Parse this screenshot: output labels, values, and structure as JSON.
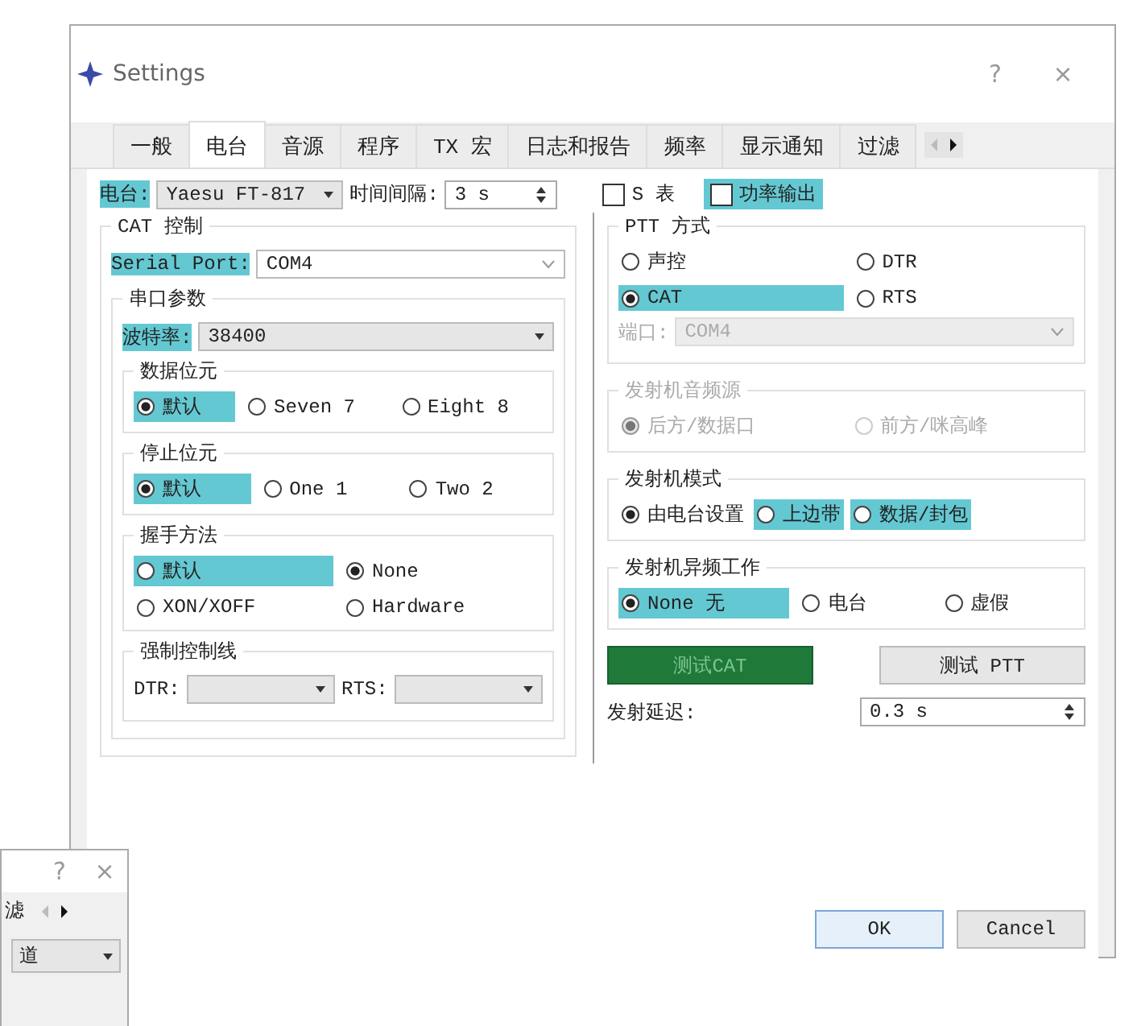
{
  "window": {
    "title": "Settings",
    "help": "?",
    "close": "×"
  },
  "tabs": [
    {
      "label": "一般",
      "selected": false
    },
    {
      "label": "电台",
      "selected": true
    },
    {
      "label": "音源",
      "selected": false
    },
    {
      "label": "程序",
      "selected": false
    },
    {
      "label": "TX 宏",
      "selected": false
    },
    {
      "label": "日志和报告",
      "selected": false
    },
    {
      "label": "频率",
      "selected": false
    },
    {
      "label": "显示通知",
      "selected": false
    },
    {
      "label": "过滤",
      "selected": false
    }
  ],
  "rig": {
    "label": "电台:",
    "value": "Yaesu FT-817",
    "highlighted": true
  },
  "poll_interval": {
    "label": "时间间隔:",
    "value": "3 s"
  },
  "checkboxes": [
    {
      "label": "S 表",
      "checked": false,
      "highlighted": false
    },
    {
      "label": "功率输出",
      "checked": false,
      "highlighted": true
    }
  ],
  "cat_control": {
    "title": "CAT 控制",
    "serial_port": {
      "label": "Serial Port:",
      "value": "COM4",
      "highlighted": true
    },
    "serial_params": {
      "title": "串口参数",
      "baud": {
        "label": "波特率:",
        "value": "38400",
        "highlighted": true
      },
      "groups": [
        {
          "title": "数据位元",
          "options": [
            {
              "label": "默认",
              "selected": true,
              "highlighted": true
            },
            {
              "label": "Seven 7",
              "selected": false,
              "highlighted": false
            },
            {
              "label": "Eight 8",
              "selected": false,
              "highlighted": false
            }
          ]
        },
        {
          "title": "停止位元",
          "options": [
            {
              "label": "默认",
              "selected": true,
              "highlighted": true
            },
            {
              "label": "One 1",
              "selected": false,
              "highlighted": false
            },
            {
              "label": "Two 2",
              "selected": false,
              "highlighted": false
            }
          ]
        },
        {
          "title": "握手方法",
          "options": [
            {
              "label": "默认",
              "selected": false,
              "highlighted": true
            },
            {
              "label": "None",
              "selected": true,
              "highlighted": false
            },
            {
              "label": "XON/XOFF",
              "selected": false,
              "highlighted": false
            },
            {
              "label": "Hardware",
              "selected": false,
              "highlighted": false
            }
          ]
        }
      ],
      "force_lines": {
        "title": "强制控制线",
        "fields": [
          {
            "label": "DTR:"
          },
          {
            "label": "RTS:"
          }
        ]
      }
    }
  },
  "right_groups": [
    {
      "title": "PTT 方式",
      "disabled": false,
      "options": [
        {
          "label": "声控",
          "selected": false,
          "highlighted": false
        },
        {
          "label": "DTR",
          "selected": false,
          "highlighted": false
        },
        {
          "label": "CAT",
          "selected": true,
          "highlighted": true
        },
        {
          "label": "RTS",
          "selected": false,
          "highlighted": false
        }
      ],
      "port": {
        "label": "端口:",
        "value": "COM4",
        "disabled": true
      }
    },
    {
      "title": "发射机音频源",
      "disabled": true,
      "options": [
        {
          "label": "后方/数据口",
          "selected": true,
          "highlighted": false
        },
        {
          "label": "前方/咪高峰",
          "selected": false,
          "highlighted": false
        }
      ]
    },
    {
      "title": "发射机模式",
      "disabled": false,
      "options": [
        {
          "label": "由电台设置",
          "selected": true,
          "highlighted": false
        },
        {
          "label": "上边带",
          "selected": false,
          "highlighted": true
        },
        {
          "label": "数据/封包",
          "selected": false,
          "highlighted": true
        }
      ]
    },
    {
      "title": "发射机异频工作",
      "disabled": false,
      "options": [
        {
          "label": "None 无",
          "selected": true,
          "highlighted": true
        },
        {
          "label": "电台",
          "selected": false,
          "highlighted": false
        },
        {
          "label": "虚假",
          "selected": false,
          "highlighted": false
        }
      ]
    }
  ],
  "test_buttons": [
    {
      "label": "测试CAT",
      "active": true
    },
    {
      "label": "测试 PTT",
      "active": false
    }
  ],
  "tx_delay": {
    "label": "发射延迟:",
    "value": "0.3 s"
  },
  "footer_buttons": [
    {
      "label": "OK",
      "default": true
    },
    {
      "label": "Cancel",
      "default": false
    }
  ],
  "back_window": {
    "help": "?",
    "close": "×",
    "tab": "滤",
    "field": "道"
  }
}
